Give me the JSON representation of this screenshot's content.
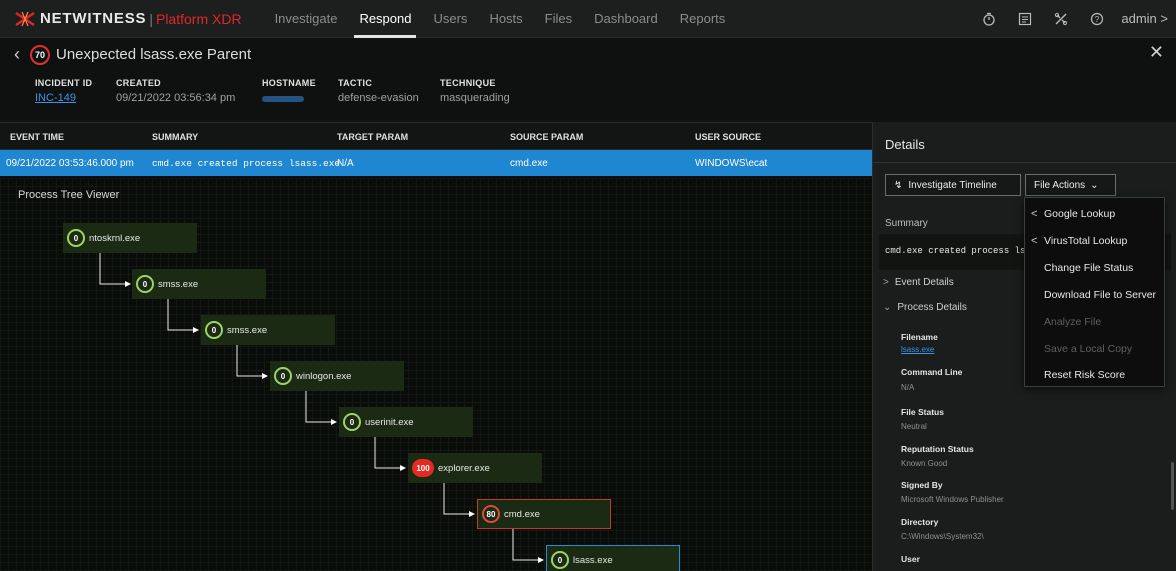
{
  "nav": {
    "brand": "NETWITNESS",
    "product": "Platform XDR",
    "items": [
      "Investigate",
      "Respond",
      "Users",
      "Hosts",
      "Files",
      "Dashboard",
      "Reports"
    ],
    "active": "Respond",
    "user": "admin",
    "icons": [
      "timer-icon",
      "checklist-icon",
      "tools-icon",
      "help-icon"
    ]
  },
  "incident": {
    "risk_score": "70",
    "title": "Unexpected lsass.exe Parent",
    "fields": {
      "incident_id_label": "INCIDENT ID",
      "incident_id": "INC-149",
      "created_label": "CREATED",
      "created": "09/21/2022 03:56:34 pm",
      "hostname_label": "HOSTNAME",
      "tactic_label": "TACTIC",
      "tactic": "defense-evasion",
      "technique_label": "TECHNIQUE",
      "technique": "masquerading"
    }
  },
  "events": {
    "columns": [
      "EVENT TIME",
      "SUMMARY",
      "TARGET PARAM",
      "SOURCE PARAM",
      "USER SOURCE"
    ],
    "row": {
      "time": "09/21/2022 03:53:46.000 pm",
      "summary": "cmd.exe created process lsass.exe",
      "target": "N/A",
      "source": "cmd.exe",
      "user": "WINDOWS\\ecat"
    }
  },
  "tree": {
    "title": "Process Tree Viewer",
    "nodes": [
      {
        "score": "0",
        "name": "ntoskrnl.exe",
        "level": "low"
      },
      {
        "score": "0",
        "name": "smss.exe",
        "level": "low"
      },
      {
        "score": "0",
        "name": "smss.exe",
        "level": "low"
      },
      {
        "score": "0",
        "name": "winlogon.exe",
        "level": "low"
      },
      {
        "score": "0",
        "name": "userinit.exe",
        "level": "low"
      },
      {
        "score": "100",
        "name": "explorer.exe",
        "level": "high"
      },
      {
        "score": "80",
        "name": "cmd.exe",
        "level": "med"
      },
      {
        "score": "0",
        "name": "lsass.exe",
        "level": "low"
      }
    ]
  },
  "details": {
    "title": "Details",
    "investigate_btn": "Investigate Timeline",
    "file_actions_btn": "File Actions",
    "summary_label": "Summary",
    "summary_text": "cmd.exe created process ls",
    "event_details": "Event Details",
    "process_details": "Process Details",
    "fields": [
      {
        "label": "Filename",
        "value": "lsass.exe",
        "link": true
      },
      {
        "label": "Command Line",
        "value": "N/A"
      },
      {
        "label": "File Status",
        "value": "Neutral"
      },
      {
        "label": "Reputation Status",
        "value": "Known Good"
      },
      {
        "label": "Signed By",
        "value": "Microsoft Windows Publisher"
      },
      {
        "label": "Directory",
        "value": "C:\\Windows\\System32\\"
      },
      {
        "label": "User",
        "value": ""
      }
    ]
  },
  "file_actions_menu": {
    "items": [
      {
        "label": "Google Lookup",
        "submenu": true,
        "enabled": true
      },
      {
        "label": "VirusTotal Lookup",
        "submenu": true,
        "enabled": true
      },
      {
        "label": "Change File Status",
        "submenu": false,
        "enabled": true
      },
      {
        "label": "Download File to Server",
        "submenu": false,
        "enabled": true
      },
      {
        "label": "Analyze File",
        "submenu": false,
        "enabled": false
      },
      {
        "label": "Save a Local Copy",
        "submenu": false,
        "enabled": false
      },
      {
        "label": "Reset Risk Score",
        "submenu": false,
        "enabled": true
      }
    ]
  },
  "colors": {
    "accent_red": "#e0262b",
    "selection_blue": "#1f86d1",
    "link_blue": "#3c93e8",
    "node_green": "#1b2a13"
  }
}
